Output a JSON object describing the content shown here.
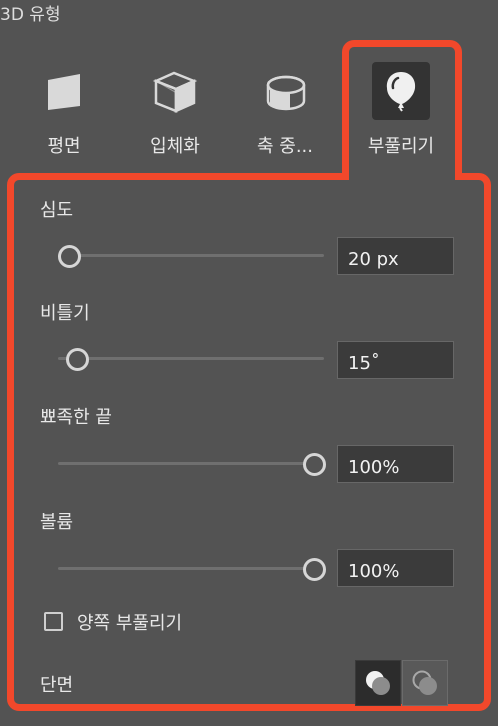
{
  "panel": {
    "title": "3D 유형"
  },
  "types": [
    {
      "label": "평면",
      "icon": "plane-icon",
      "selected": false
    },
    {
      "label": "입체화",
      "icon": "extrude-cube-icon",
      "selected": false
    },
    {
      "label": "축 중...",
      "icon": "revolve-cylinder-icon",
      "selected": false
    },
    {
      "label": "부풀리기",
      "icon": "balloon-inflate-icon",
      "selected": true
    }
  ],
  "inflate": {
    "depth": {
      "label": "심도",
      "value": "20 px",
      "level": 0.04
    },
    "twist": {
      "label": "비틀기",
      "value": "15˚",
      "level": 0.08
    },
    "sharp_edge": {
      "label": "뾰족한 끝",
      "value": "100%",
      "level": 1.0
    },
    "volume": {
      "label": "볼륨",
      "value": "100%",
      "level": 1.0
    },
    "inflate_both_sides": {
      "label": "양쪽 부풀리기",
      "checked": false
    },
    "profile": {
      "label": "단면",
      "options": [
        "profile-solid-icon",
        "profile-hollow-icon"
      ],
      "selected_index": 0
    }
  },
  "colors": {
    "highlight": "#f2482b",
    "background": "#535353"
  }
}
